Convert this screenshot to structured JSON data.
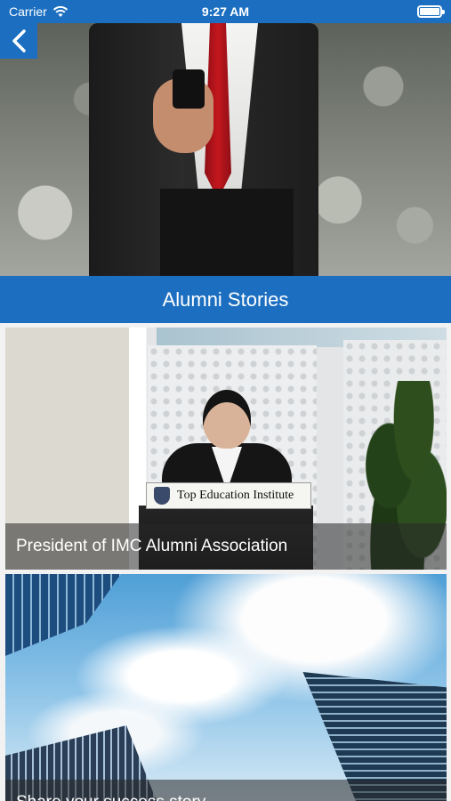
{
  "status_bar": {
    "carrier": "Carrier",
    "time": "9:27 AM",
    "wifi_icon": "wifi-icon",
    "battery_icon": "battery-icon"
  },
  "nav": {
    "back_icon": "chevron-left-icon"
  },
  "section": {
    "title": "Alumni Stories"
  },
  "stories": [
    {
      "caption": "President of IMC Alumni Association",
      "lectern_sign": "Top Education Institute"
    },
    {
      "caption": "Share your success story"
    }
  ],
  "colors": {
    "primary": "#1c6fc0",
    "caption_overlay": "rgba(40,40,40,0.55)"
  }
}
